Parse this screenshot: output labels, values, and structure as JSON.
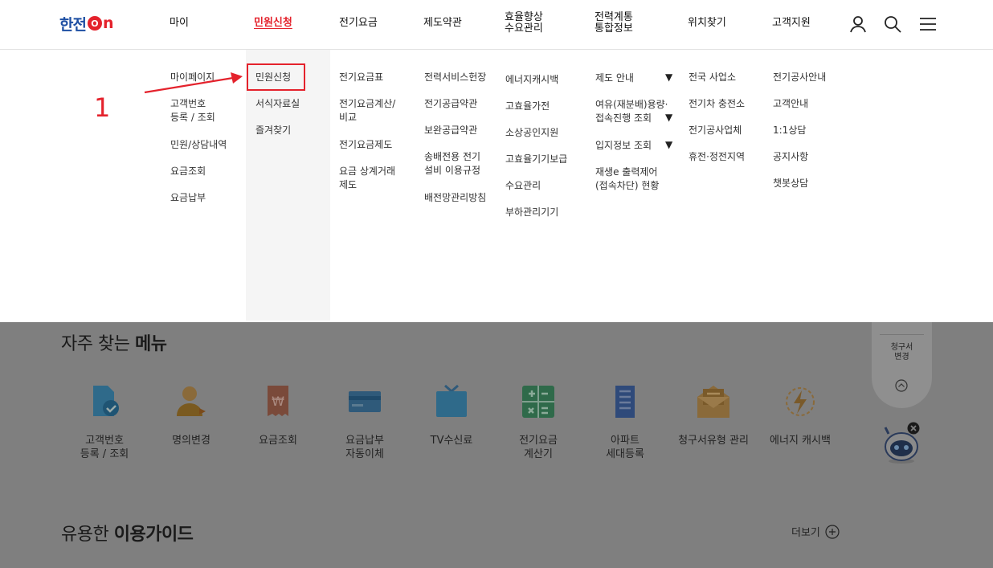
{
  "logo": {
    "text": "한전",
    "o": "O",
    "n": "n"
  },
  "gnb": [
    {
      "label": "마이"
    },
    {
      "label": "민원신청"
    },
    {
      "label": "전기요금"
    },
    {
      "label": "제도약관"
    },
    {
      "label": "효율향상\n수요관리"
    },
    {
      "label": "전력계통\n통합정보"
    },
    {
      "label": "위치찾기"
    },
    {
      "label": "고객지원"
    }
  ],
  "menu": {
    "my": [
      "마이페이지",
      "고객번호\n등록 / 조회",
      "민원/상담내역",
      "요금조회",
      "요금납부"
    ],
    "civil": [
      "민원신청",
      "서식자료실",
      "즐겨찾기"
    ],
    "bill": [
      "전기요금표",
      "전기요금계산/\n비교",
      "전기요금제도",
      "요금 상계거래\n제도"
    ],
    "terms": [
      "전력서비스헌장",
      "전기공급약관",
      "보완공급약관",
      "송배전용 전기\n설비 이용규정",
      "배전망관리방침"
    ],
    "efficiency": [
      "에너지캐시백",
      "고효율가전",
      "소상공인지원",
      "고효율기기보급",
      "수요관리",
      "부하관리기기"
    ],
    "grid": [
      "제도 안내",
      "여유(재분배)용량·\n접속진행 조회",
      "입지정보 조회",
      "재생e 출력제어\n(접속차단) 현황"
    ],
    "location": [
      "전국 사업소",
      "전기차 충전소",
      "전기공사업체",
      "휴전·정전지역"
    ],
    "support": [
      "전기공사안내",
      "고객안내",
      "1:1상담",
      "공지사항",
      "챗봇상담"
    ]
  },
  "annotation": {
    "number": "1"
  },
  "quick_menu": {
    "title_prefix": "자주 찾는 ",
    "title_bold": "메뉴",
    "items": [
      {
        "label": "고객번호\n등록 / 조회",
        "icon": "document-check-icon"
      },
      {
        "label": "명의변경",
        "icon": "person-change-icon"
      },
      {
        "label": "요금조회",
        "icon": "bill-won-icon"
      },
      {
        "label": "요금납부\n자동이체",
        "icon": "card-icon"
      },
      {
        "label": "TV수신료",
        "icon": "tv-icon"
      },
      {
        "label": "전기요금\n계산기",
        "icon": "calculator-icon"
      },
      {
        "label": "아파트\n세대등록",
        "icon": "apartment-icon"
      },
      {
        "label": "청구서유형 관리",
        "icon": "mail-invoice-icon"
      },
      {
        "label": "에너지 캐시백",
        "icon": "energy-bolt-icon"
      }
    ]
  },
  "guide": {
    "title_prefix": "유용한 ",
    "title_bold": "이용가이드",
    "more_label": "더보기"
  },
  "float": {
    "label": "청구서\n변경"
  },
  "colors": {
    "brand_blue": "#1e4fa3",
    "brand_red": "#e4222c",
    "dim_overlay": "#7f7f7f"
  }
}
